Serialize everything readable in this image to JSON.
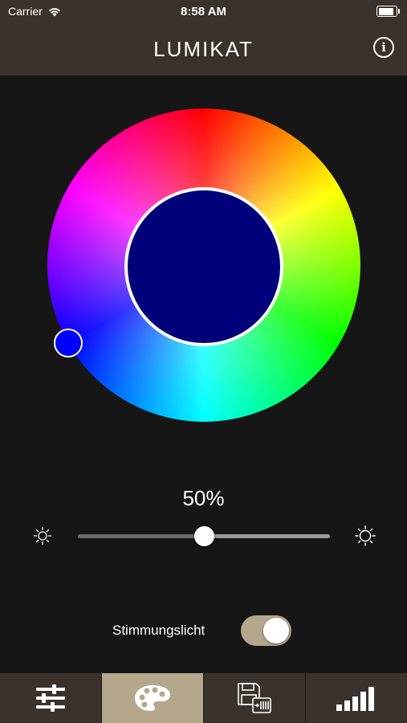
{
  "status_bar": {
    "carrier": "Carrier",
    "time": "8:58 AM",
    "battery_level": 1.0
  },
  "header": {
    "logo": "LUMIKAT",
    "info_icon": "info-icon"
  },
  "color_picker": {
    "selected_color": "#00007a",
    "handle_color": "#0000ff",
    "wheel_icon": "color-wheel"
  },
  "brightness": {
    "label": "50%",
    "value": 0.5,
    "min_icon": "sun-small-icon",
    "max_icon": "sun-large-icon"
  },
  "mood_light": {
    "label": "Stimmungslicht",
    "on": true
  },
  "tabs": [
    {
      "name": "sliders-icon",
      "active": false
    },
    {
      "name": "palette-icon",
      "active": true
    },
    {
      "name": "save-device-icon",
      "active": false
    },
    {
      "name": "signal-bars-icon",
      "active": false
    }
  ],
  "colors": {
    "bar": "#3a322c",
    "accent": "#b5a78c",
    "background": "#161616"
  }
}
